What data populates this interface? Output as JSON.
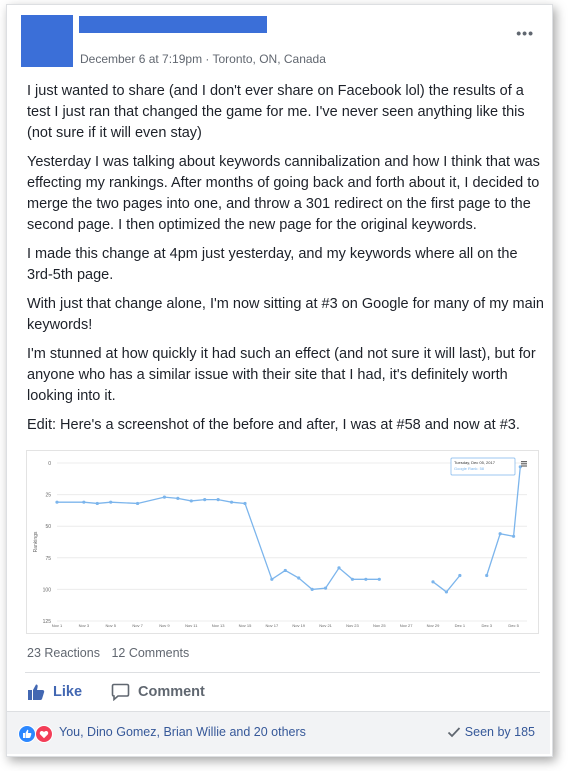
{
  "post": {
    "meta": "December 6 at 7:19pm · Toronto, ON, Canada",
    "more_label": "•••",
    "paragraphs": [
      "I just wanted to share (and I don't ever share on Facebook lol) the results of a test I just ran that changed the game for me. I've never seen anything like this (not sure if it will even stay)",
      "Yesterday I was talking about keywords cannibalization and how I think that was effecting my rankings. After months of going back and forth about it, I decided to merge the two pages into one, and throw a 301 redirect on the first page to the second page. I then optimized the new page for the original keywords.",
      "I made this change at 4pm just yesterday, and my keywords where all on the 3rd-5th page.",
      "With just that change alone, I'm now sitting at #3 on Google for many of my main keywords!",
      "I'm stunned at how quickly it had such an effect (and not sure it will last), but for anyone who has a similar issue with their site that I had, it's definitely worth looking into it.",
      "Edit: Here's a screenshot of the before and after, I was at #58 and now at #3."
    ]
  },
  "chart_data": {
    "type": "line",
    "ylabel": "Rankings",
    "ylim": [
      125,
      0
    ],
    "yticks": [
      "0",
      "25",
      "50",
      "75",
      "100",
      "125"
    ],
    "x_tick_labels": [
      "Nov 1",
      "Nov 3",
      "Nov 5",
      "Nov 7",
      "Nov 9",
      "Nov 11",
      "Nov 13",
      "Nov 15",
      "Nov 17",
      "Nov 19",
      "Nov 21",
      "Nov 23",
      "Nov 25",
      "Nov 27",
      "Nov 29",
      "Dec 1",
      "Dec 3",
      "Dec 5"
    ],
    "tooltip": {
      "date": "Tuesday, Dec 05, 2017",
      "value": "Google Rank: 58"
    },
    "series": [
      {
        "day": [
          1,
          2,
          3,
          4,
          5,
          6,
          7,
          8,
          9,
          10,
          11,
          12,
          13,
          14,
          15,
          16,
          17,
          18,
          19,
          20,
          21,
          22,
          23,
          24,
          25,
          26,
          27,
          28,
          29,
          30,
          31,
          32,
          33,
          34,
          35
        ],
        "values": [
          31,
          31,
          30,
          32,
          31,
          31,
          32,
          31,
          29,
          27,
          28,
          30,
          29,
          29,
          31,
          32,
          92,
          85,
          91,
          100,
          99,
          83,
          92,
          92,
          92,
          null,
          null,
          null,
          94,
          102,
          89,
          null,
          89,
          58,
          58,
          3
        ]
      }
    ],
    "point_days": [
      1,
      3,
      4,
      5,
      7,
      9,
      10,
      11,
      12,
      13,
      14,
      15,
      17,
      18,
      19,
      20,
      21,
      22,
      23,
      24,
      25,
      29,
      30,
      31,
      33,
      34,
      35,
      35.5
    ],
    "point_values": [
      31,
      31,
      32,
      31,
      32,
      27,
      28,
      30,
      29,
      29,
      31,
      32,
      92,
      85,
      91,
      100,
      99,
      83,
      92,
      92,
      92,
      94,
      102,
      89,
      89,
      56,
      58,
      3
    ]
  },
  "stats": {
    "reactions": "23 Reactions",
    "comments": "12 Comments"
  },
  "actions": {
    "like": "Like",
    "comment": "Comment"
  },
  "footer": {
    "names": "You, Dino Gomez, Brian Willie and 20 others",
    "seen": "Seen by 185"
  },
  "colors": {
    "brand": "#4267b2",
    "line": "#7cb5ec",
    "like": "#2d88ff",
    "love": "#f33e58"
  }
}
